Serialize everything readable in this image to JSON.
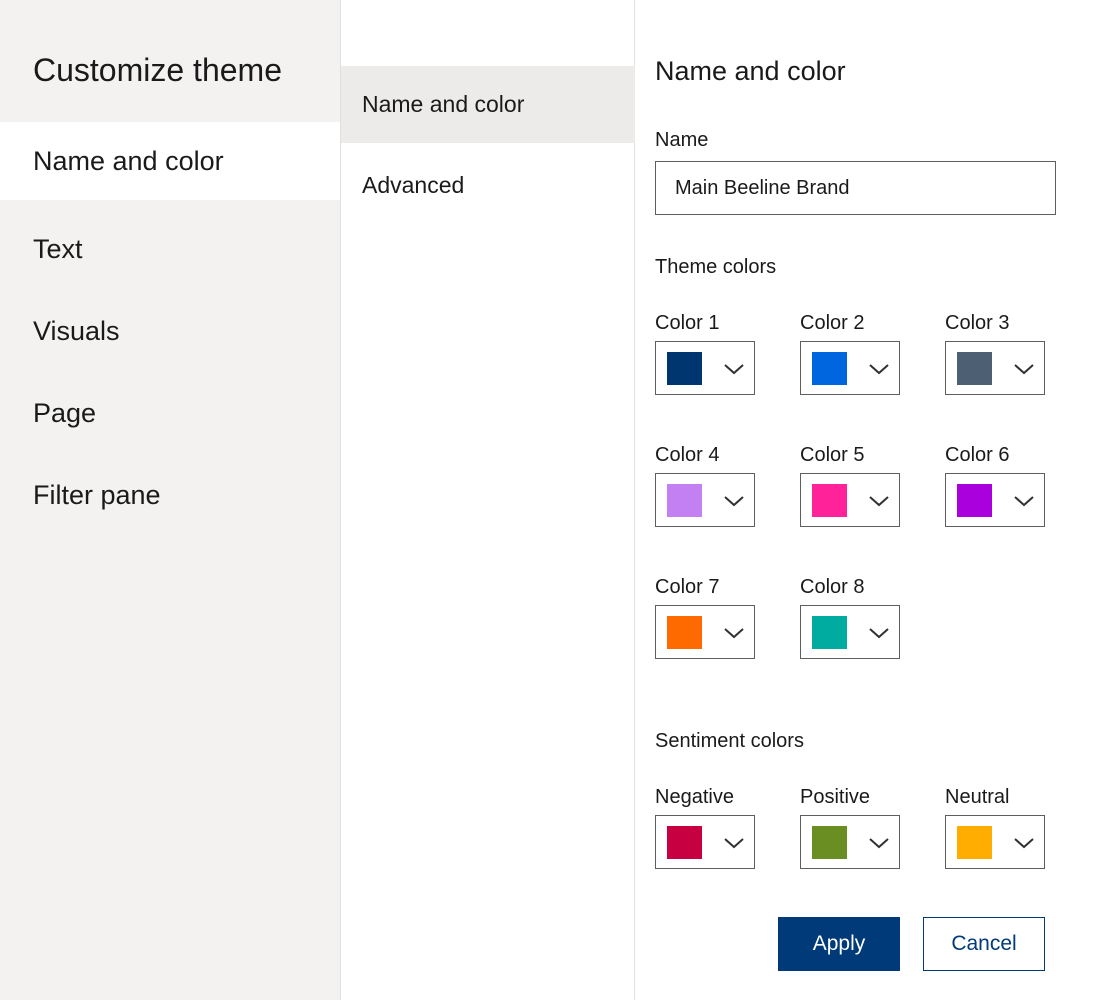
{
  "left_nav": {
    "title": "Customize theme",
    "items": [
      {
        "label": "Name and color",
        "selected": true
      },
      {
        "label": "Text",
        "selected": false
      },
      {
        "label": "Visuals",
        "selected": false
      },
      {
        "label": "Page",
        "selected": false
      },
      {
        "label": "Filter pane",
        "selected": false
      }
    ]
  },
  "sub_nav": {
    "items": [
      {
        "label": "Name and color",
        "selected": true
      },
      {
        "label": "Advanced",
        "selected": false
      }
    ]
  },
  "content": {
    "title": "Name and color",
    "name_label": "Name",
    "name_value": "Main Beeline Brand",
    "theme_colors_label": "Theme colors",
    "theme_colors": [
      {
        "label": "Color 1",
        "color": "#003670"
      },
      {
        "label": "Color 2",
        "color": "#0066e0"
      },
      {
        "label": "Color 3",
        "color": "#4d5f73"
      },
      {
        "label": "Color 4",
        "color": "#c380f3"
      },
      {
        "label": "Color 5",
        "color": "#ff2298"
      },
      {
        "label": "Color 6",
        "color": "#aa00dd"
      },
      {
        "label": "Color 7",
        "color": "#ff6a00"
      },
      {
        "label": "Color 8",
        "color": "#00aca0"
      }
    ],
    "sentiment_colors_label": "Sentiment colors",
    "sentiment_colors": [
      {
        "label": "Negative",
        "color": "#c70042"
      },
      {
        "label": "Positive",
        "color": "#6b8e23"
      },
      {
        "label": "Neutral",
        "color": "#ffad00"
      }
    ],
    "apply_label": "Apply",
    "cancel_label": "Cancel"
  },
  "colors": {
    "primary_button": "#003a78",
    "left_nav_background": "#f3f2f1",
    "selected_sub_item_background": "#edebe9"
  },
  "icons": {
    "picker_dropdown": "chevron-down-icon"
  }
}
